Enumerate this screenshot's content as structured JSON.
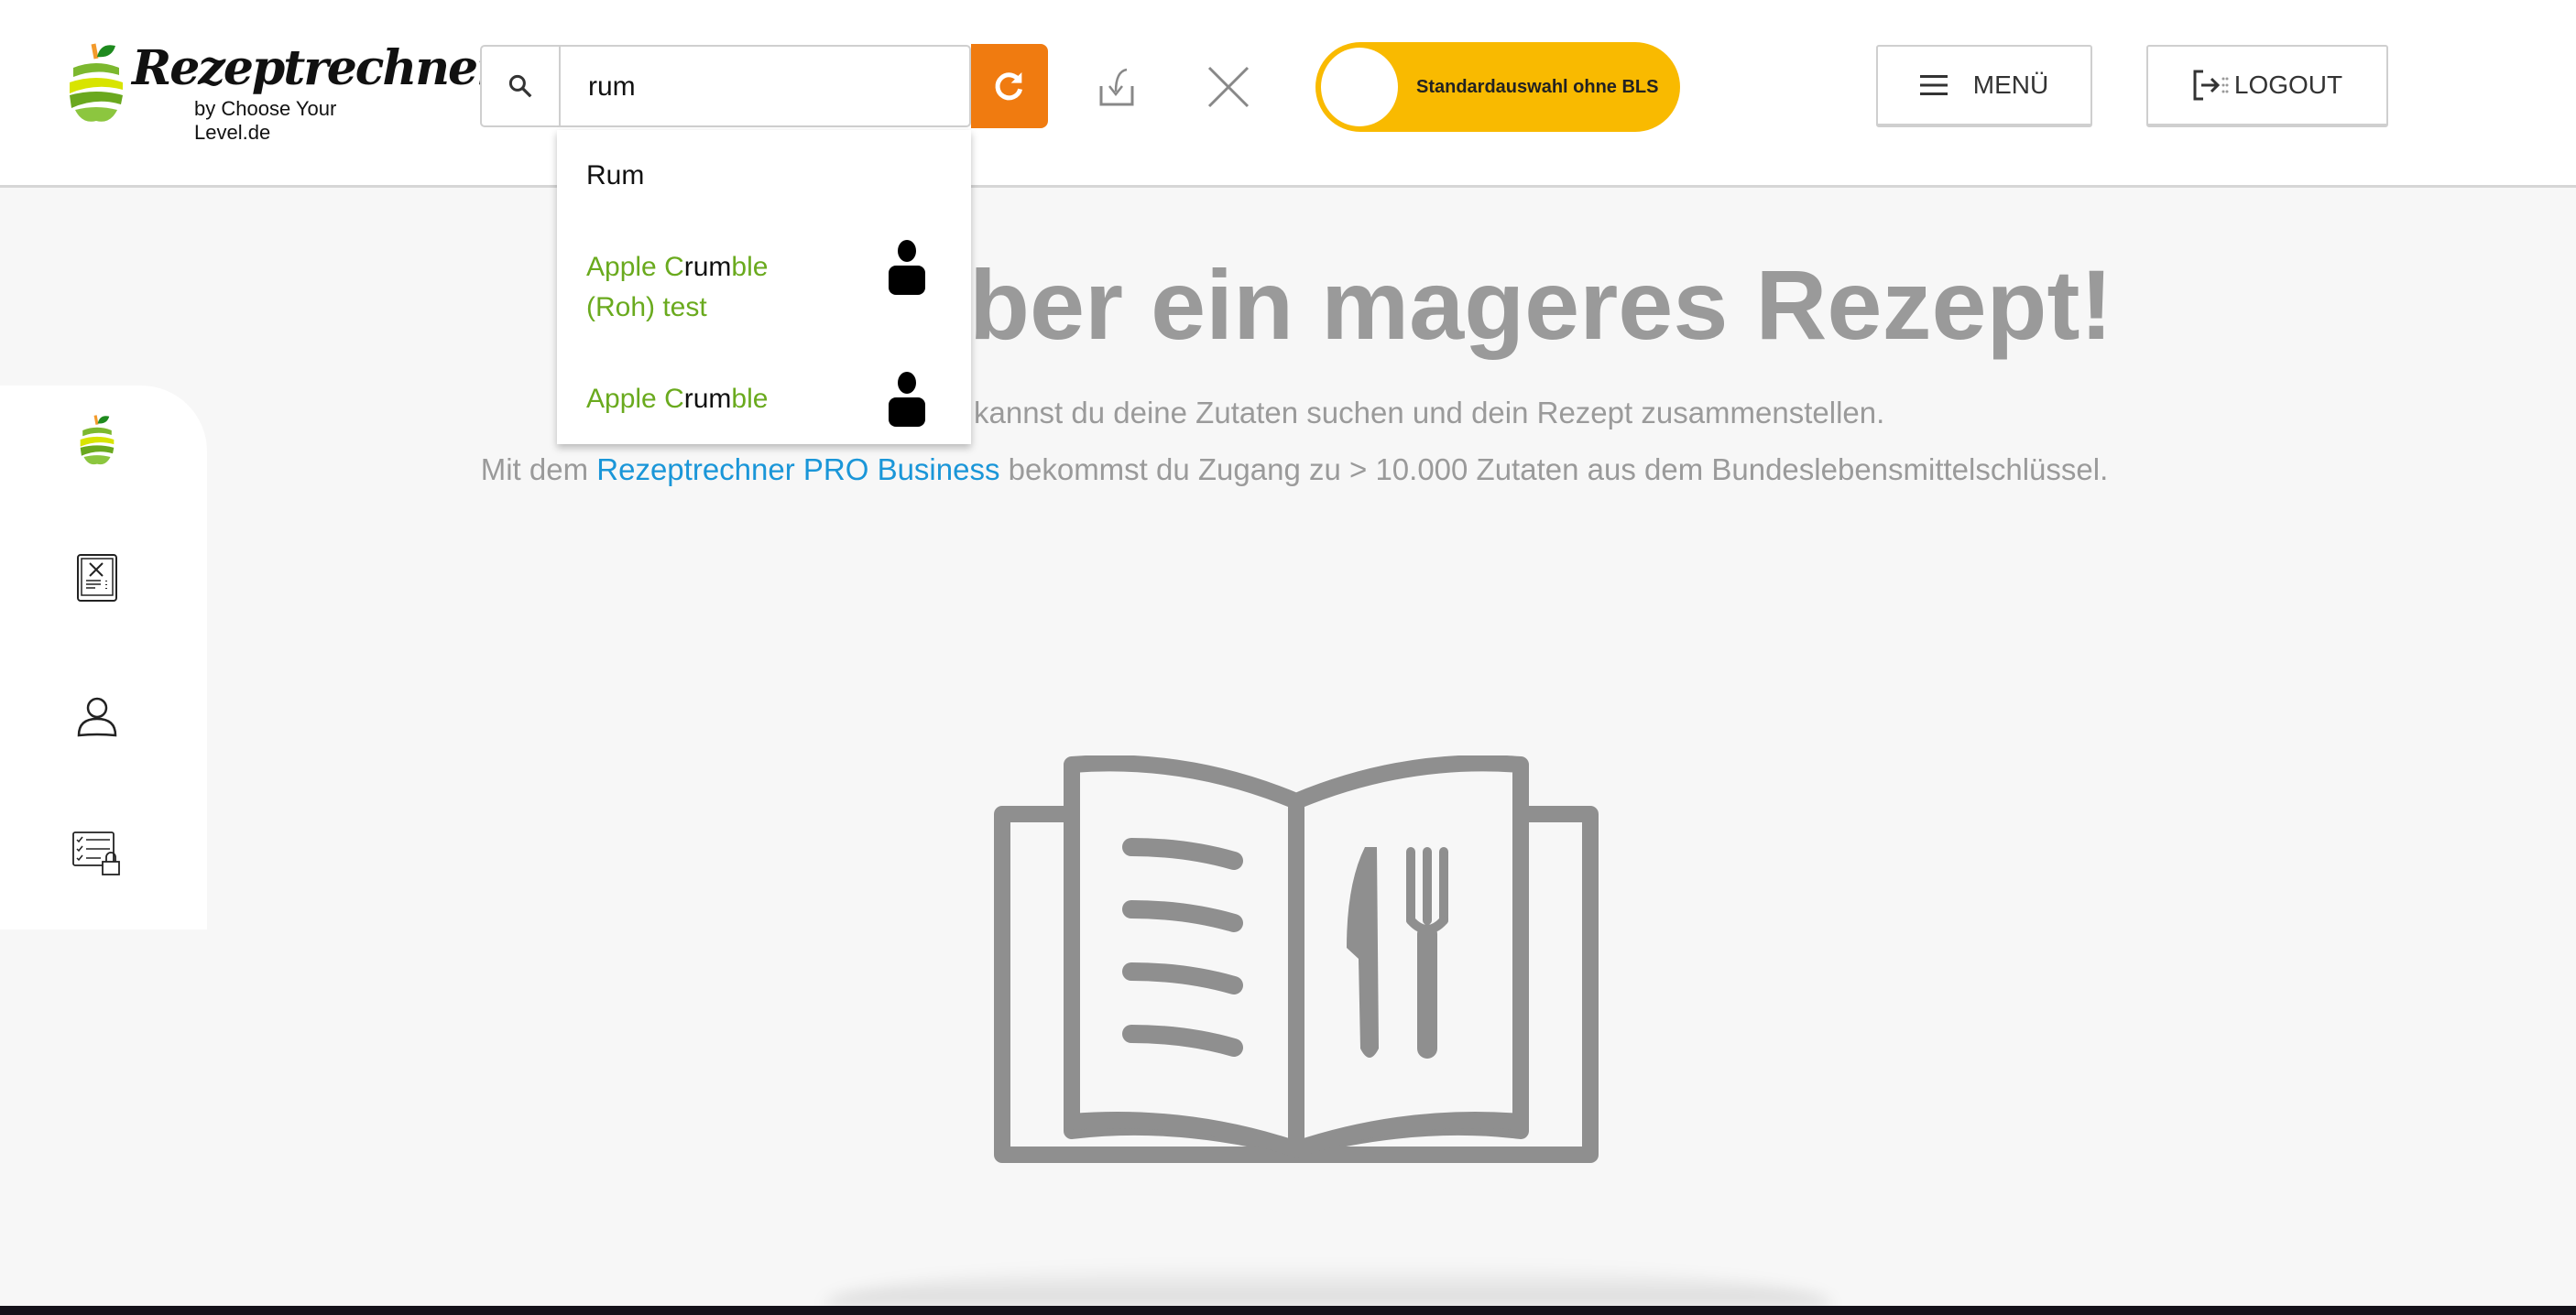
{
  "header": {
    "logo": {
      "title": "Rezeptrechner",
      "subtitle": "by Choose Your Level.de"
    },
    "search": {
      "value": "rum",
      "icon": "search-icon"
    },
    "refresh_icon": "refresh-icon",
    "import_icon": "import-icon",
    "clear_icon": "close-icon",
    "toggle": {
      "label": "Standardauswahl ohne BLS",
      "color": "#F9BA00"
    },
    "menu_label": "MENÜ",
    "logout_label": "LOGOUT"
  },
  "dropdown": {
    "items": [
      {
        "label": "Rum",
        "user_recipe": false
      },
      {
        "pre": "Apple C",
        "match": "rum",
        "post": "ble",
        "line2": "(Roh) test",
        "user_recipe": true
      },
      {
        "pre": "Apple C",
        "match": "rum",
        "post": "ble",
        "user_recipe": true
      }
    ]
  },
  "sidebar": {
    "items": [
      "apple-logo-icon",
      "recipe-tablet-icon",
      "user-icon",
      "locked-checklist-icon"
    ]
  },
  "main": {
    "headline": "ber ein mageres Rezept!",
    "line2": "kannst du deine Zutaten suchen und dein Rezept zusammenstellen.",
    "line3_pre": "Mit dem ",
    "line3_link": "Rezeptrechner PRO Business",
    "line3_post": " bekommst du Zugang zu > 10.000 Zutaten aus dem Bundeslebensmittelschlüssel."
  },
  "colors": {
    "accent_orange": "#F07B10",
    "match_green": "#6AAA1E",
    "link_blue": "#1A96D8",
    "text_gray": "#9A9A9A"
  }
}
